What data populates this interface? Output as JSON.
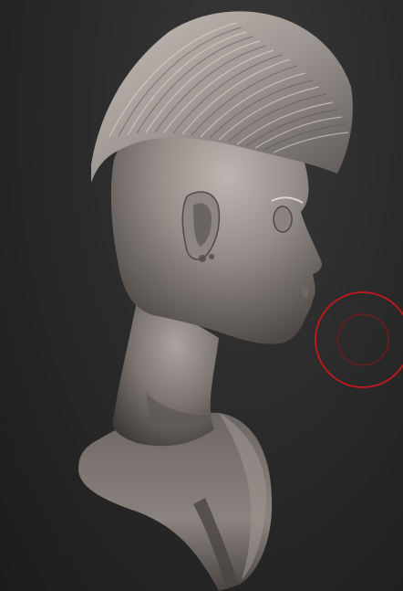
{
  "viewport": {
    "background_top": "#3a3a3a",
    "background_bottom": "#1c1c1c"
  },
  "sculpt": {
    "subject": "sculpted-bust-with-mohawk",
    "material_color": "#8f8884",
    "highlight_color": "#c9c2bd",
    "shadow_color": "#4a4542"
  },
  "brush_cursor": {
    "icon": "brush-cursor-icon",
    "outer_ring_color": "#c8161d",
    "inner_ring_color": "#7a1a1d"
  }
}
